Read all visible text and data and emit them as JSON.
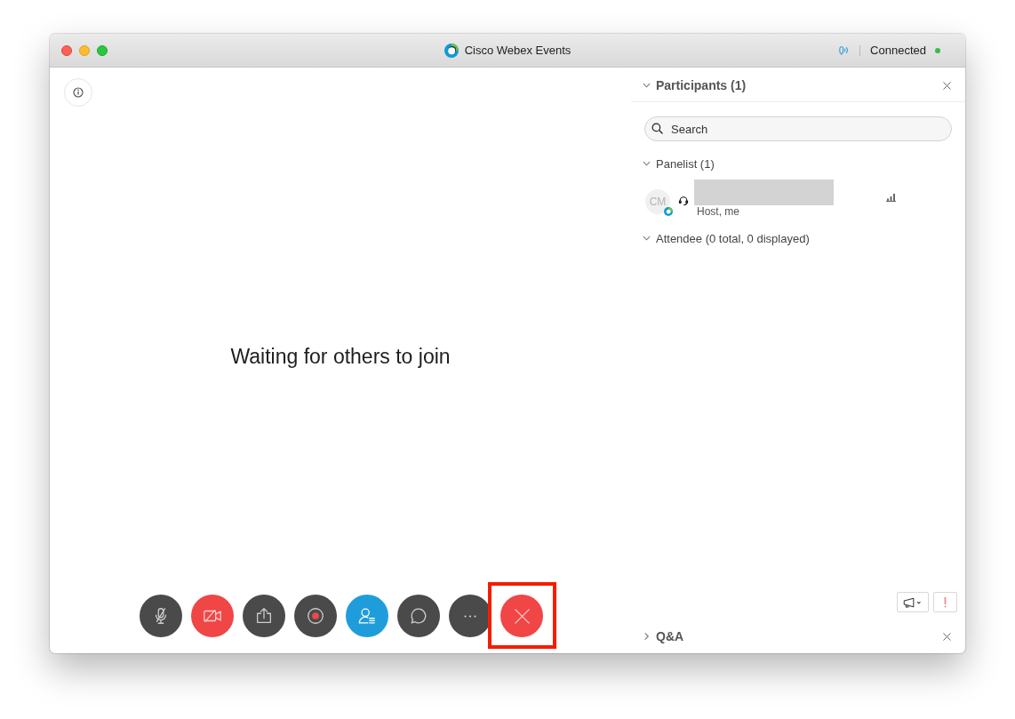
{
  "window": {
    "title": "Cisco Webex Events",
    "status": "Connected",
    "connected": true
  },
  "stage": {
    "message": "Waiting for others to join"
  },
  "controls": [
    {
      "kind": "mute",
      "off": false,
      "active": false,
      "highlighted": false
    },
    {
      "kind": "video",
      "off": true,
      "active": false,
      "highlighted": false
    },
    {
      "kind": "share",
      "off": false,
      "active": false,
      "highlighted": false
    },
    {
      "kind": "record",
      "off": false,
      "active": false,
      "highlighted": false
    },
    {
      "kind": "participants",
      "off": false,
      "active": true,
      "highlighted": false
    },
    {
      "kind": "chat",
      "off": false,
      "active": false,
      "highlighted": false
    },
    {
      "kind": "more",
      "off": false,
      "active": false,
      "highlighted": false
    },
    {
      "kind": "end",
      "off": false,
      "active": false,
      "highlighted": true
    }
  ],
  "participants_panel": {
    "title": "Participants (1)",
    "expanded": true,
    "search": {
      "placeholder": "Search"
    },
    "groups": [
      {
        "label": "Panelist (1)",
        "expanded": true,
        "members": [
          {
            "initials": "CM",
            "role": "Host, me"
          }
        ]
      },
      {
        "label": "Attendee (0 total, 0 displayed)",
        "expanded": true
      }
    ]
  },
  "qa_panel": {
    "title": "Q&A",
    "expanded": false
  }
}
